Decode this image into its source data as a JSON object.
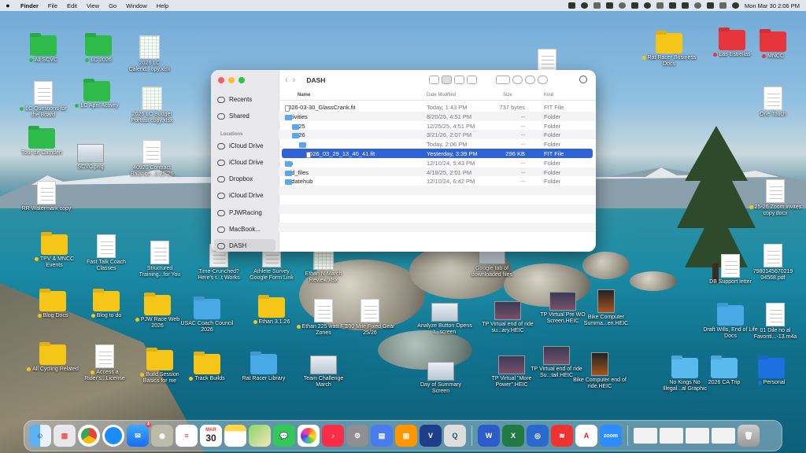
{
  "menubar": {
    "app": "Finder",
    "menus": [
      "File",
      "Edit",
      "View",
      "Go",
      "Window",
      "Help"
    ],
    "clock": "Mon Mar 30  2:06 PM"
  },
  "desktop_icons": [
    {
      "label": "All SCVC",
      "kind": "folder",
      "color": "#2fbb4a",
      "tag": "green"
    },
    {
      "label": "LC 2026",
      "kind": "folder",
      "color": "#2fbb4a",
      "tag": "green"
    },
    {
      "label": "2026 LC Calend...opy.xlsx",
      "kind": "sheet"
    },
    {
      "label": "LC Questions for the Board",
      "kind": "doc",
      "tag": "green"
    },
    {
      "label": "LC April Activity",
      "kind": "folder",
      "color": "#2fbb4a",
      "tag": "green"
    },
    {
      "label": "2026 LC Budget Portrait copy.xlsx",
      "kind": "sheet"
    },
    {
      "label": "Tour de Camden",
      "kind": "folder",
      "color": "#2fbb4a"
    },
    {
      "label": "SCVC.png",
      "kind": "shot"
    },
    {
      "label": "40920 Contract Balance...3.25.26",
      "kind": "doc"
    },
    {
      "label": "RR Watermark copy",
      "kind": "doc"
    },
    {
      "label": "TPV & MNCC Events",
      "kind": "folder",
      "color": "#f5c518",
      "tag": "yellow"
    },
    {
      "label": "Fast Talk Coach Classes",
      "kind": "doc"
    },
    {
      "label": "Structured Training...for You",
      "kind": "doc"
    },
    {
      "label": "Time-Crunched? Here's t...t Works",
      "kind": "doc"
    },
    {
      "label": "Athlete Survey Google Form Link",
      "kind": "doc"
    },
    {
      "label": "Ethan N March Review.xlsx",
      "kind": "sheet"
    },
    {
      "label": "Blog Docs",
      "kind": "folder",
      "color": "#f5c518",
      "tag": "yellow"
    },
    {
      "label": "Blog to do",
      "kind": "folder",
      "color": "#f5c518",
      "tag": "yellow"
    },
    {
      "label": "PJW Race Web 2026",
      "kind": "folder",
      "color": "#f5c518",
      "tag": "yellow"
    },
    {
      "label": "USAC Coach Council 2026",
      "kind": "folder",
      "color": "#48a9e6"
    },
    {
      "label": "Ethan 3.1.26",
      "kind": "folder",
      "color": "#f5c518",
      "tag": "yellow"
    },
    {
      "label": "Ethan 225 watt FTP Zones",
      "kind": "doc",
      "tag": "yellow"
    },
    {
      "label": "100 Mile Fixed Gear 25/26",
      "kind": "doc"
    },
    {
      "label": "Analyze Button Opens t...screen",
      "kind": "shot"
    },
    {
      "label": "TP Virtual end of ride su...ary.HEIC",
      "kind": "shot-dark"
    },
    {
      "label": "TP Virtual Pre WO Screen.HEIC",
      "kind": "shot-dark"
    },
    {
      "label": "Bike Computer Summa...en.HEIC",
      "kind": "shot-tall"
    },
    {
      "label": "All Cycling Related",
      "kind": "folder",
      "color": "#f5c518",
      "tag": "yellow"
    },
    {
      "label": "Access a Rider's...License",
      "kind": "doc",
      "tag": "yellow"
    },
    {
      "label": "Build Session Basics for me",
      "kind": "folder",
      "color": "#f5c518",
      "tag": "yellow"
    },
    {
      "label": "Track Builds",
      "kind": "folder",
      "color": "#f5c518",
      "tag": "yellow"
    },
    {
      "label": "Rat Racer Library",
      "kind": "folder",
      "color": "#48a9e6"
    },
    {
      "label": "Team Challenge March",
      "kind": "shot"
    },
    {
      "label": "Day of Summary Screen",
      "kind": "shot"
    },
    {
      "label": "TP Virtual \"More Power\".HEIC",
      "kind": "shot-dark"
    },
    {
      "label": "TP Virtual end of ride Su...tail.HEIC",
      "kind": "shot-dark"
    },
    {
      "label": "Bike Computer end of ride.HEIC",
      "kind": "shot-tall"
    },
    {
      "label": "Google tab of downloaded files",
      "kind": "shot"
    },
    {
      "label": "Rat Racer Business Docs",
      "kind": "folder",
      "color": "#f5c518",
      "tag": "yellow"
    },
    {
      "label": "Las Estrellas",
      "kind": "folder",
      "color": "#e6363b",
      "tag": "red"
    },
    {
      "label": "MNCC",
      "kind": "folder",
      "color": "#e6363b",
      "tag": "red"
    },
    {
      "label": "One Touch",
      "kind": "doc"
    },
    {
      "label": "25-26 Zoom invites copy.docx",
      "kind": "doc",
      "tag": "yellow"
    },
    {
      "label": "7980145670219 04568.pdf",
      "kind": "doc"
    },
    {
      "label": "DB Support letter",
      "kind": "doc"
    },
    {
      "label": "Draft Wills, End of Life Docs",
      "kind": "folder",
      "color": "#48a9e6"
    },
    {
      "label": "01 Dile no al Favoriti...-13.m4a",
      "kind": "doc"
    },
    {
      "label": "No Kings No Illegal...al Graphic",
      "kind": "folder",
      "color": "#5ab9ef"
    },
    {
      "label": "2026 CA Trip",
      "kind": "folder",
      "color": "#5ab9ef"
    },
    {
      "label": "Personal",
      "kind": "folder",
      "color": "#1e6fe0",
      "tag": "blue"
    },
    {
      "label": "WKO",
      "kind": "doc"
    }
  ],
  "finder": {
    "path_title": "DASH",
    "sidebar": {
      "favorites": [
        "Recents",
        "Shared"
      ],
      "locations_heading": "Locations",
      "locations": [
        "iCloud Drive",
        "iCloud Drive",
        "Dropbox",
        "iCloud Drive",
        "PJWRacing",
        "MacBook...",
        "DASH"
      ]
    },
    "columns": {
      "name": "Name",
      "date": "Date Modified",
      "size": "Size",
      "kind": "Kind"
    },
    "rows": [
      {
        "name": "2026-03-30_GlassCrank.fit",
        "date": "Today, 1:43 PM",
        "size": "737 bytes",
        "kind": "FIT File",
        "indent": 0,
        "type": "file",
        "disclosure": ""
      },
      {
        "name": "activities",
        "date": "8/20/25, 4:51 PM",
        "size": "--",
        "kind": "Folder",
        "indent": 0,
        "type": "folder",
        "disclosure": "▾"
      },
      {
        "name": "2025",
        "date": "12/25/25, 4:51 PM",
        "size": "--",
        "kind": "Folder",
        "indent": 1,
        "type": "folder",
        "disclosure": "›"
      },
      {
        "name": "2026",
        "date": "3/21/26, 2:07 PM",
        "size": "--",
        "kind": "Folder",
        "indent": 1,
        "type": "folder",
        "disclosure": "▾"
      },
      {
        "name": "03",
        "date": "Today, 2:06 PM",
        "size": "--",
        "kind": "Folder",
        "indent": 2,
        "type": "folder",
        "disclosure": "▾"
      },
      {
        "name": "2026_03_29_13_40_41.fit",
        "date": "Yesterday, 3:39 PM",
        "size": "296 KB",
        "kind": "FIT File",
        "indent": 3,
        "type": "file",
        "disclosure": "",
        "selected": true
      },
      {
        "name": "bin",
        "date": "12/10/24, 5:43 PM",
        "size": "--",
        "kind": "Folder",
        "indent": 0,
        "type": "folder",
        "disclosure": "›"
      },
      {
        "name": "add_files",
        "date": "4/18/25, 2:01 PM",
        "size": "--",
        "kind": "Folder",
        "indent": 0,
        "type": "folder",
        "disclosure": "›"
      },
      {
        "name": "updatehub",
        "date": "12/10/24, 6:42 PM",
        "size": "--",
        "kind": "Folder",
        "indent": 0,
        "type": "folder",
        "disclosure": "›"
      }
    ]
  },
  "dock": {
    "calendar_month": "MAR",
    "calendar_day": "30",
    "mail_badge": "4",
    "apps": [
      "finder",
      "launchpad",
      "chrome",
      "safari",
      "mail",
      "contacts",
      "reminders",
      "calendar",
      "notes",
      "maps",
      "messages",
      "photos",
      "music",
      "settings",
      "preview",
      "books",
      "vpn",
      "quicktime",
      "word",
      "excel",
      "agent",
      "express",
      "acrobat",
      "zoom",
      "trash"
    ]
  }
}
